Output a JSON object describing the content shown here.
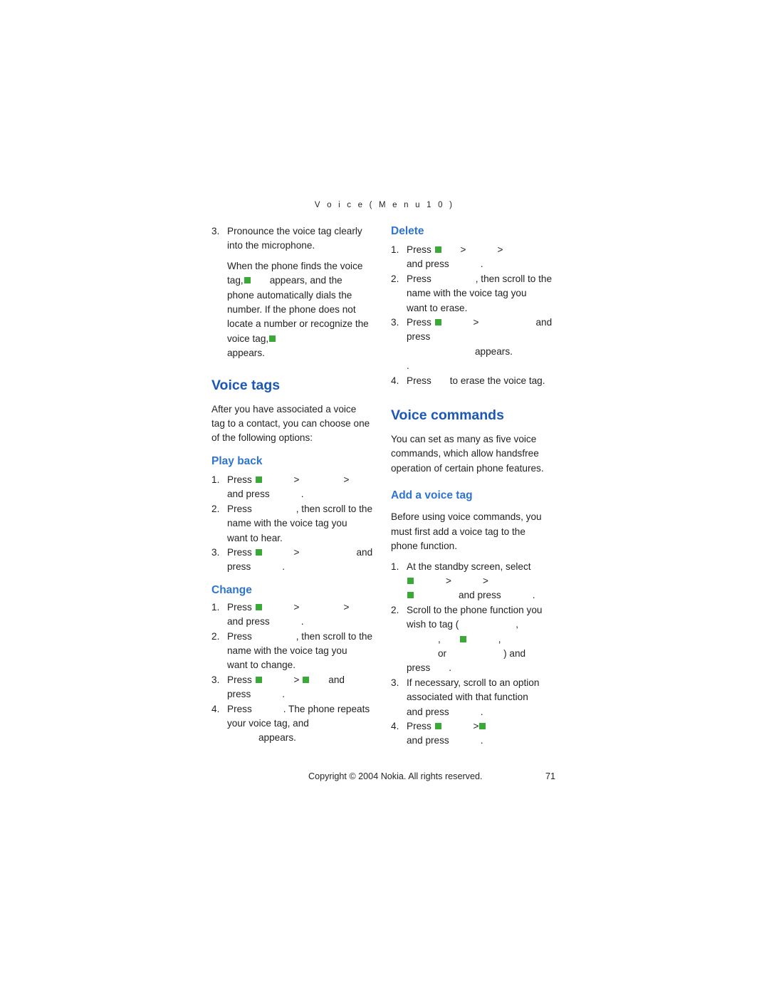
{
  "header": {
    "running_head": "V o i c e   ( M e n u   1 0 )"
  },
  "left_column": {
    "step3_line1": "Pronounce the voice tag clearly",
    "step3_line2": "into the microphone.",
    "para1_line1": "When the phone finds the voice",
    "para1_line2_a": "tag,",
    "para1_line2_b": "appears, and the",
    "para1_line3": "phone automatically dials the",
    "para1_line4": "number. If the phone does not",
    "para1_line5": "locate a number or recognize the",
    "para1_line6_a": "voice tag,",
    "para1_line7": "appears.",
    "voice_tags_heading": "Voice tags",
    "voice_tags_intro_1": "After you have associated a voice",
    "voice_tags_intro_2": "tag to a contact, you can choose one",
    "voice_tags_intro_3": "of the following options:",
    "play_back_heading": "Play back",
    "playback_s1_a": "Press",
    "playback_s1_b": ">",
    "playback_s1_c": ">",
    "playback_s1_d": "and press",
    "playback_s1_e": ".",
    "playback_s2_a": "Press",
    "playback_s2_b": ", then scroll to the",
    "playback_s2_c": "name with the voice tag you",
    "playback_s2_d": "want to hear.",
    "playback_s3_a": "Press",
    "playback_s3_b": ">",
    "playback_s3_c": "and",
    "playback_s3_d": "press",
    "playback_s3_e": ".",
    "change_heading": "Change",
    "change_s1_a": "Press",
    "change_s1_b": ">",
    "change_s1_c": ">",
    "change_s1_d": "and press",
    "change_s1_e": ".",
    "change_s2_a": "Press",
    "change_s2_b": ", then scroll to the",
    "change_s2_c": "name with the voice tag you",
    "change_s2_d": "want to change.",
    "change_s3_a": "Press",
    "change_s3_b": ">",
    "change_s3_c": "and",
    "change_s3_d": "press",
    "change_s3_e": ".",
    "change_s4_a": "Press",
    "change_s4_b": ". The phone repeats",
    "change_s4_c": "your voice tag, and",
    "change_s4_d": "appears."
  },
  "right_column": {
    "delete_heading": "Delete",
    "delete_s1_a": "Press",
    "delete_s1_b": ">",
    "delete_s1_c": ">",
    "delete_s1_d": "and press",
    "delete_s1_e": ".",
    "delete_s2_a": "Press",
    "delete_s2_b": ", then scroll to the",
    "delete_s2_c": "name with the voice tag you",
    "delete_s2_d": "want to erase.",
    "delete_s3_a": "Press",
    "delete_s3_b": ">",
    "delete_s3_c": "and press",
    "delete_s3_d": "appears.",
    "delete_s3_e": ".",
    "delete_s4_a": "Press",
    "delete_s4_b": "to erase the voice tag.",
    "voice_commands_heading": "Voice commands",
    "vc_intro_1": "You can set as many as five voice",
    "vc_intro_2": "commands, which allow handsfree",
    "vc_intro_3": "operation of certain phone features.",
    "add_voice_tag_heading": "Add a voice tag",
    "avt_intro_1": "Before using voice commands, you",
    "avt_intro_2": "must first add a voice tag to the",
    "avt_intro_3": "phone function.",
    "avt_s1_a": "At the standby screen, select",
    "avt_s1_b": ">",
    "avt_s1_c": ">",
    "avt_s1_d": "and press",
    "avt_s1_e": ".",
    "avt_s2_a": "Scroll to the phone function you",
    "avt_s2_b": "wish to tag (",
    "avt_s2_c": ",",
    "avt_s2_d": ",",
    "avt_s2_e": ",",
    "avt_s2_f": "or",
    "avt_s2_g": ") and",
    "avt_s2_h": "press",
    "avt_s2_i": ".",
    "avt_s3_a": "If necessary, scroll to an option",
    "avt_s3_b": "associated with that function",
    "avt_s3_c": "and press",
    "avt_s3_d": ".",
    "avt_s4_a": "Press",
    "avt_s4_b": ">",
    "avt_s4_c": "and press",
    "avt_s4_d": "."
  },
  "footer": {
    "copyright": "Copyright © 2004 Nokia. All rights reserved.",
    "page_number": "71"
  },
  "colors": {
    "heading_blue": "#1a57b8",
    "subheading_blue": "#2f74d0",
    "marker_green": "#3aa936",
    "text": "#231f20"
  }
}
